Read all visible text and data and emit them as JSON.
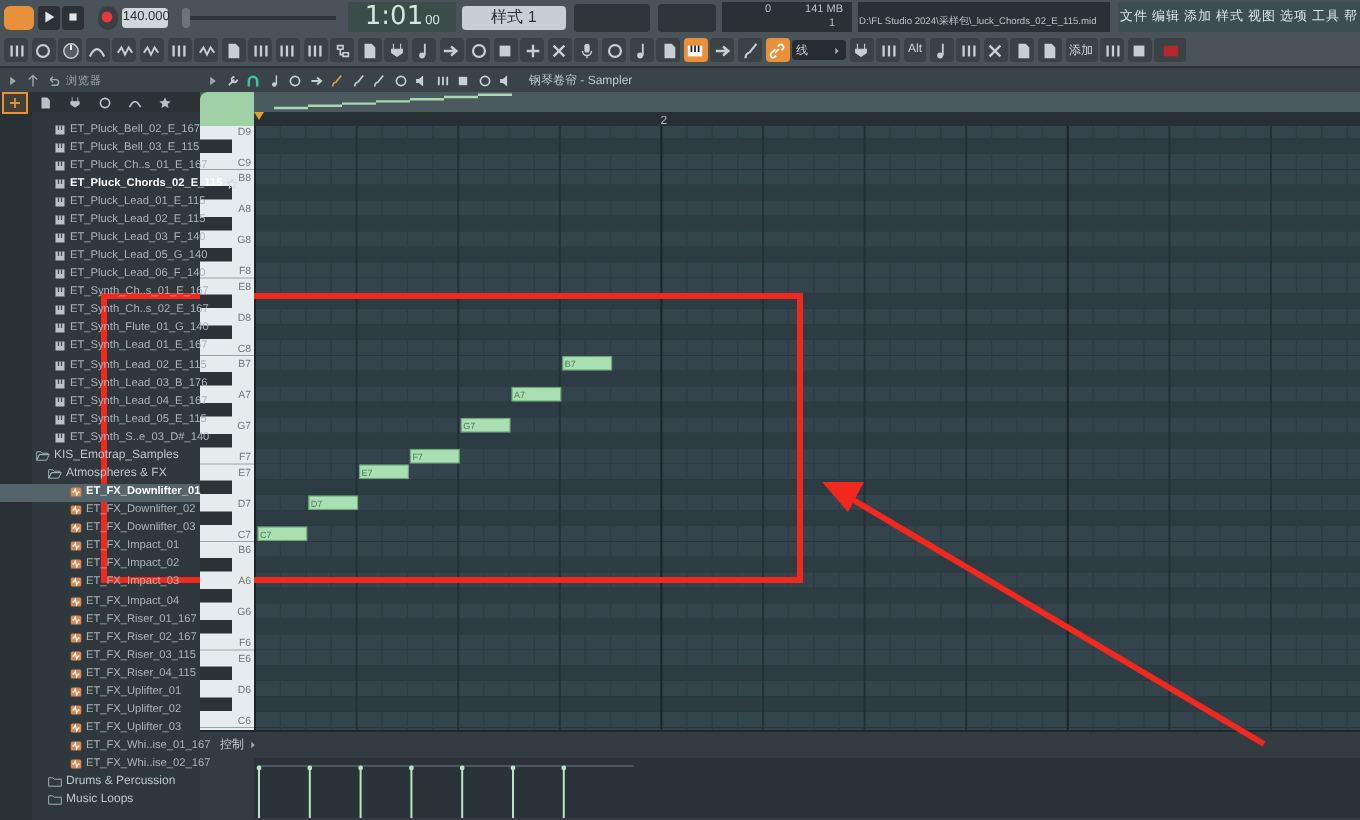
{
  "transport": {
    "tempo": "140.000",
    "time": "1:01",
    "time_small": "00",
    "pattern": "样式 1"
  },
  "master_slider": {
    "level": 0
  },
  "monitor": {
    "cpu": "0",
    "memory": "141 MB",
    "polyphony": "1"
  },
  "hint_bar": {
    "text": "D:\\FL Studio 2024\\采样包\\_luck_Chords_02_E_115.mid"
  },
  "menu": [
    "文件",
    "编辑",
    "添加",
    "样式",
    "视图",
    "选项",
    "工具",
    "帮"
  ],
  "toolbar": {
    "toggles": [
      {
        "on": true
      },
      {
        "on": false
      },
      {
        "on": false
      },
      {
        "on": true
      }
    ],
    "snap": "线",
    "buttons": [
      "Alt",
      "添加"
    ]
  },
  "browser": {
    "title": "浏览器",
    "tabs": [
      {
        "selected": true
      },
      {
        "selected": false
      },
      {
        "selected": false
      },
      {
        "selected": false
      },
      {
        "selected": false
      },
      {
        "selected": false
      }
    ],
    "items": [
      {
        "kind": "midi_file",
        "name": "ET_Pluck_Bell_02_E_167",
        "selected": false,
        "active": false
      },
      {
        "kind": "midi_file",
        "name": "ET_Pluck_Bell_03_E_115",
        "selected": false,
        "active": false
      },
      {
        "kind": "midi_file",
        "name": "ET_Pluck_Ch..s_01_E_167",
        "selected": false,
        "active": false
      },
      {
        "kind": "midi_file",
        "name": "ET_Pluck_Chords_02_E_115",
        "selected": false,
        "active": true
      },
      {
        "kind": "midi_file",
        "name": "ET_Pluck_Lead_01_E_115",
        "selected": false,
        "active": false
      },
      {
        "kind": "midi_file",
        "name": "ET_Pluck_Lead_02_E_115",
        "selected": false,
        "active": false
      },
      {
        "kind": "midi_file",
        "name": "ET_Pluck_Lead_03_F_140",
        "selected": false,
        "active": false
      },
      {
        "kind": "midi_file",
        "name": "ET_Pluck_Lead_05_G_140",
        "selected": false,
        "active": false
      },
      {
        "kind": "midi_file",
        "name": "ET_Pluck_Lead_06_F_140",
        "selected": false,
        "active": false
      },
      {
        "kind": "midi_file",
        "name": "ET_Synth_Ch..s_01_E_167",
        "selected": false,
        "active": false
      },
      {
        "kind": "midi_file",
        "name": "ET_Synth_Ch..s_02_E_167",
        "selected": false,
        "active": false
      },
      {
        "kind": "midi_file",
        "name": "ET_Synth_Flute_01_G_140",
        "selected": false,
        "active": false
      },
      {
        "kind": "midi_file",
        "name": "ET_Synth_Lead_01_E_167",
        "selected": false,
        "active": false
      },
      {
        "kind": "midi_file",
        "name": "ET_Synth_Lead_02_E_115",
        "selected": false,
        "active": false
      },
      {
        "kind": "midi_file",
        "name": "ET_Synth_Lead_03_B_176",
        "selected": false,
        "active": false
      },
      {
        "kind": "midi_file",
        "name": "ET_Synth_Lead_04_E_167",
        "selected": false,
        "active": false
      },
      {
        "kind": "midi_file",
        "name": "ET_Synth_Lead_05_E_115",
        "selected": false,
        "active": false
      },
      {
        "kind": "midi_file",
        "name": "ET_Synth_S..e_03_D#_140",
        "selected": false,
        "active": false
      },
      {
        "kind": "folder",
        "name": "KIS_Emotrap_Samples",
        "expanded": true,
        "children": [
          {
            "kind": "folder",
            "name": "Atmospheres & FX",
            "expanded": true,
            "children": [
              {
                "kind": "audio_file",
                "name": "ET_FX_Downlifter_01",
                "selected": true,
                "active": true
              },
              {
                "kind": "audio_file",
                "name": "ET_FX_Downlifter_02",
                "selected": false,
                "active": false
              },
              {
                "kind": "audio_file",
                "name": "ET_FX_Downlifter_03",
                "selected": false,
                "active": false
              },
              {
                "kind": "audio_file",
                "name": "ET_FX_Impact_01",
                "selected": false,
                "active": false
              },
              {
                "kind": "audio_file",
                "name": "ET_FX_Impact_02",
                "selected": false,
                "active": false
              },
              {
                "kind": "audio_file",
                "name": "ET_FX_Impact_03",
                "selected": false,
                "active": false
              },
              {
                "kind": "audio_file",
                "name": "ET_FX_Impact_04",
                "selected": false,
                "active": false
              },
              {
                "kind": "audio_file",
                "name": "ET_FX_Riser_01_167",
                "selected": false,
                "active": false
              },
              {
                "kind": "audio_file",
                "name": "ET_FX_Riser_02_167",
                "selected": false,
                "active": false
              },
              {
                "kind": "audio_file",
                "name": "ET_FX_Riser_03_115",
                "selected": false,
                "active": false
              },
              {
                "kind": "audio_file",
                "name": "ET_FX_Riser_04_115",
                "selected": false,
                "active": false
              },
              {
                "kind": "audio_file",
                "name": "ET_FX_Uplifter_01",
                "selected": false,
                "active": false
              },
              {
                "kind": "audio_file",
                "name": "ET_FX_Uplifter_02",
                "selected": false,
                "active": false
              },
              {
                "kind": "audio_file",
                "name": "ET_FX_Uplifter_03",
                "selected": false,
                "active": false
              },
              {
                "kind": "audio_file",
                "name": "ET_FX_Whi..ise_01_167",
                "selected": false,
                "active": false
              },
              {
                "kind": "audio_file",
                "name": "ET_FX_Whi..ise_02_167",
                "selected": false,
                "active": false
              }
            ]
          },
          {
            "kind": "folder",
            "name": "Drums & Percussion",
            "expanded": false
          },
          {
            "kind": "folder",
            "name": "Music Loops",
            "expanded": false
          }
        ]
      }
    ]
  },
  "piano_roll": {
    "title": "钢琴卷帘 - Sampler",
    "bar_labels": [
      "2"
    ],
    "key_labels": [
      "D9",
      "C9",
      "B8",
      "A8",
      "G8",
      "F8",
      "E8",
      "D8",
      "C8",
      "B7",
      "A7",
      "G7",
      "F7",
      "E7",
      "D7",
      "C7",
      "B6",
      "A6",
      "G6",
      "F6",
      "E6",
      "D6",
      "C6"
    ],
    "notes": [
      {
        "label": "C7"
      },
      {
        "label": "D7"
      },
      {
        "label": "E7"
      },
      {
        "label": "F7"
      },
      {
        "label": "G7"
      },
      {
        "label": "A7"
      },
      {
        "label": "B7"
      }
    ],
    "control_label": "控制"
  }
}
